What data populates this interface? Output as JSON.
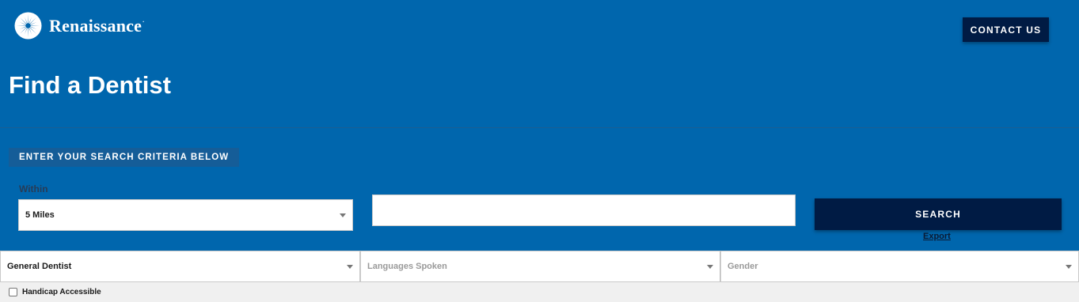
{
  "brand": {
    "name": "Renaissance",
    "trademark": "."
  },
  "header": {
    "contact_label": "CONTACT US"
  },
  "page": {
    "title": "Find a Dentist"
  },
  "search": {
    "criteria_heading": "ENTER YOUR SEARCH CRITERIA BELOW",
    "within_label": "Within",
    "within_value": "5 Miles",
    "location_value": "",
    "search_label": "SEARCH",
    "export_label": "Export"
  },
  "filters": {
    "specialty_value": "General Dentist",
    "languages_placeholder": "Languages Spoken",
    "gender_placeholder": "Gender",
    "handicap_label": "Handicap Accessible",
    "handicap_checked": false
  },
  "colors": {
    "hero_background": "#0066ad",
    "button_dark": "#001b44",
    "page_background": "#f0f0f0"
  },
  "icons": {
    "logo": "renaissance-starburst-icon",
    "dropdown": "caret-down-icon"
  }
}
